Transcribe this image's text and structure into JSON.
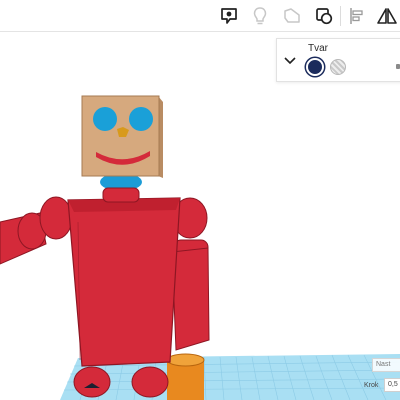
{
  "toolbar": {
    "buttons": [
      {
        "name": "comment-icon"
      },
      {
        "name": "lightbulb-icon"
      },
      {
        "name": "shape-group-icon"
      },
      {
        "name": "duplicate-icon"
      },
      {
        "name": "align-icon"
      },
      {
        "name": "mirror-icon"
      }
    ]
  },
  "shape_panel": {
    "title": "Tvar",
    "colors": {
      "solid": "#1b2b5c",
      "hole": "striped"
    }
  },
  "grid": {
    "snap_label": "Nast",
    "step_label": "Krok",
    "step_value": "0,5"
  },
  "colors": {
    "accent": "#1b2b5c",
    "robot_red": "#d42a3a",
    "head_tan": "#d6a97e",
    "eye_blue": "#1aa0d8",
    "neck_blue": "#1c9cd6",
    "grid_blue": "#a9dff3",
    "orange": "#e8891f"
  }
}
